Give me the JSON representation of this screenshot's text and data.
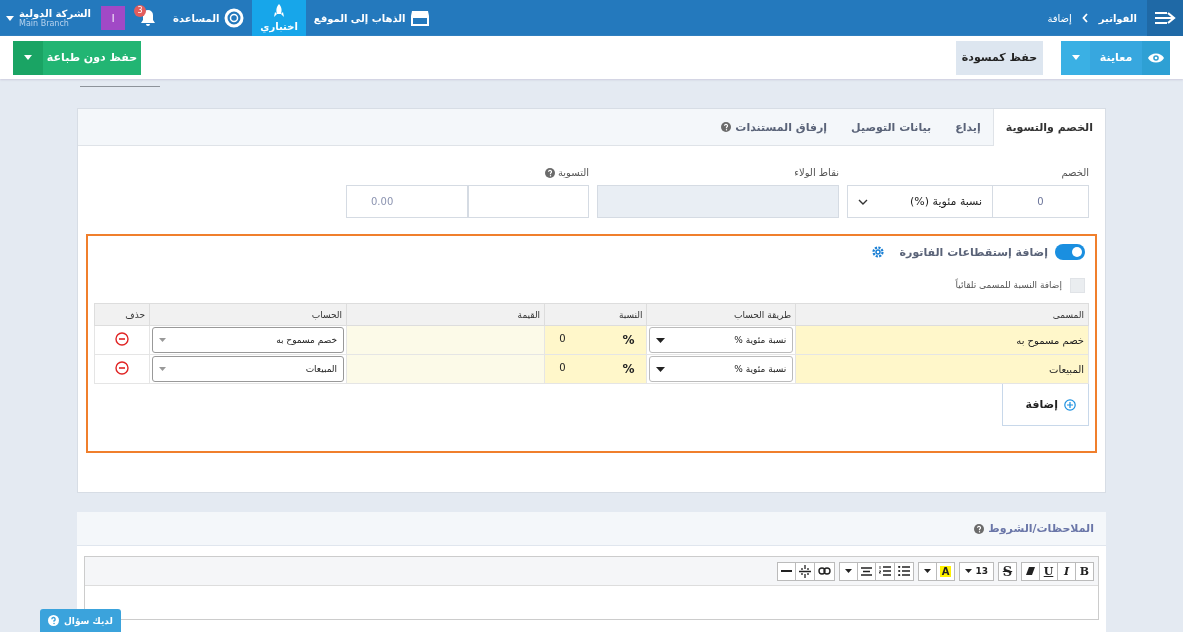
{
  "topbar": {
    "breadcrumb": [
      "الفواتير",
      "إضافة"
    ],
    "nav": [
      {
        "label": "الذهاب إلى الموقع",
        "selected": false
      },
      {
        "label": "اختباري",
        "selected": true
      },
      {
        "label": "المساعدة",
        "selected": false
      }
    ],
    "notification_badge": "3",
    "avatar": "ا",
    "company": {
      "name": "الشركة الدولية",
      "branch": "Main Branch"
    }
  },
  "actions": {
    "preview": "معاينة",
    "draft": "حفظ كمسودة",
    "save": "حفظ دون طباعة"
  },
  "tabs": [
    {
      "label": "الخصم والتسوية",
      "selected": true,
      "help": false
    },
    {
      "label": "إيداع",
      "selected": false,
      "help": false
    },
    {
      "label": "بيانات التوصيل",
      "selected": false,
      "help": false
    },
    {
      "label": "إرفاق المستندات",
      "selected": false,
      "help": true
    }
  ],
  "form": {
    "discount": {
      "label": "الخصم",
      "value": "0",
      "type": "نسبة مئوية (%)"
    },
    "loyalty": {
      "label": "نقاط الولاء",
      "disabled": true
    },
    "settlement": {
      "label": "التسوية",
      "value": "0.00"
    }
  },
  "deductions": {
    "enabled": true,
    "title": "إضافة إستقطاعات الفاتورة",
    "auto_name": {
      "label": "إضافة النسبة للمسمى تلقائياً",
      "checked": false
    },
    "columns": [
      "المسمى",
      "طريقة الحساب",
      "النسبة",
      "القيمة",
      "الحساب",
      "حذف"
    ],
    "rows": [
      {
        "name": "خصم مسموح به",
        "method": "نسبة مئوية %",
        "rate": "0",
        "unit": "%",
        "account": "خصم مسموح به"
      },
      {
        "name": "المبيعات",
        "method": "نسبة مئوية %",
        "rate": "0",
        "unit": "%",
        "account": "المبيعات"
      }
    ],
    "add_label": "إضافة"
  },
  "notes": {
    "title": "الملاحظات/الشروط",
    "toolbar": [
      [
        {
          "kind": "bold",
          "label": "B"
        },
        {
          "kind": "italic",
          "label": "I"
        },
        {
          "kind": "underline",
          "label": "U"
        },
        {
          "kind": "eraser"
        }
      ],
      [
        {
          "kind": "strike",
          "label": "S"
        }
      ],
      [
        {
          "kind": "size",
          "label": "13"
        }
      ],
      [
        {
          "kind": "highlight",
          "label": "A"
        },
        {
          "kind": "caret"
        }
      ],
      [
        {
          "kind": "bullets"
        },
        {
          "kind": "numbers"
        },
        {
          "kind": "align"
        },
        {
          "kind": "caret"
        }
      ],
      [
        {
          "kind": "link"
        },
        {
          "kind": "unlink"
        },
        {
          "kind": "rule"
        }
      ]
    ]
  },
  "help_button": "لديك سؤال"
}
